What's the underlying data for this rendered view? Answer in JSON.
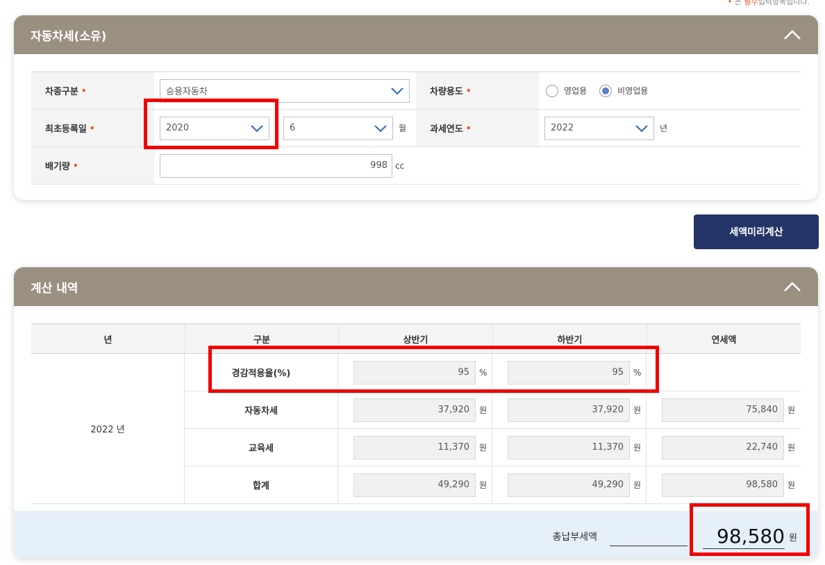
{
  "note": {
    "dot": "•",
    "prefix": "은",
    "required": "필수",
    "suffix": "입력항목입니다."
  },
  "panel1": {
    "title": "자동차세(소유)",
    "vehicle_type_label": "차종구분",
    "vehicle_type_value": "승용자동차",
    "usage_label": "차량용도",
    "usage_options": [
      {
        "label": "영업용",
        "selected": false
      },
      {
        "label": "비영업용",
        "selected": true
      }
    ],
    "first_reg_label": "최초등록일",
    "first_reg_year": "2020",
    "first_reg_month": "6",
    "month_unit": "월",
    "tax_year_label": "과세연도",
    "tax_year_value": "2022",
    "year_unit": "년",
    "displacement_label": "배기량",
    "displacement_value": "998",
    "displacement_unit": "cc",
    "required_mark": "•"
  },
  "calc_button": "세액미리계산",
  "panel2": {
    "title": "계산 내역",
    "headers": [
      "년",
      "구분",
      "상반기",
      "하반기",
      "연세액"
    ],
    "year": "2022 년",
    "rows": [
      {
        "label": "경감적용율(%)",
        "h1": "95",
        "h2": "95",
        "annual": "",
        "unit": "%"
      },
      {
        "label": "자동차세",
        "h1": "37,920",
        "h2": "37,920",
        "annual": "75,840",
        "unit": "원"
      },
      {
        "label": "교육세",
        "h1": "11,370",
        "h2": "11,370",
        "annual": "22,740",
        "unit": "원"
      },
      {
        "label": "합계",
        "h1": "49,290",
        "h2": "49,290",
        "annual": "98,580",
        "unit": "원"
      }
    ],
    "total_label": "총납부세액",
    "total_value": "98,580",
    "total_unit": "원"
  }
}
